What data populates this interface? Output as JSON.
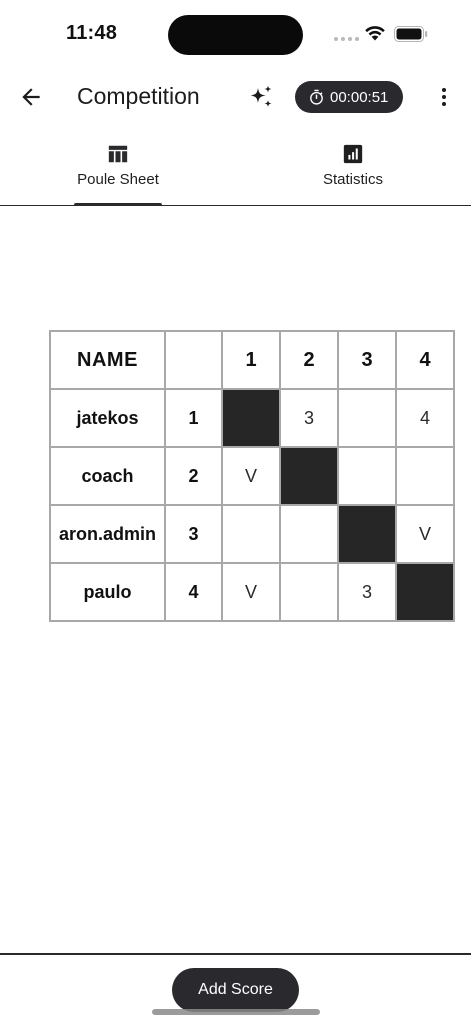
{
  "status_bar": {
    "time": "11:48"
  },
  "app_bar": {
    "title": "Competition",
    "timer": "00:00:51",
    "icons": [
      "back-arrow-icon",
      "sparkle-icon",
      "stopwatch-icon",
      "more-vert-icon"
    ]
  },
  "tabs": [
    {
      "label": "Poule Sheet",
      "icon": "table-icon",
      "active": true
    },
    {
      "label": "Statistics",
      "icon": "bar-chart-icon",
      "active": false
    }
  ],
  "poule": {
    "header": {
      "name": "NAME",
      "number": "",
      "columns": [
        "1",
        "2",
        "3",
        "4"
      ]
    },
    "rows": [
      {
        "name": "jatekos",
        "number": "1",
        "cells": [
          "",
          "3",
          "",
          "4"
        ]
      },
      {
        "name": "coach",
        "number": "2",
        "cells": [
          "V",
          "",
          "",
          ""
        ]
      },
      {
        "name": "aron.admin",
        "number": "3",
        "cells": [
          "",
          "",
          "",
          "V"
        ]
      },
      {
        "name": "paulo",
        "number": "4",
        "cells": [
          "V",
          "",
          "3",
          ""
        ]
      }
    ],
    "blocked_color": "#262626"
  },
  "actions": {
    "add_score_label": "Add Score"
  },
  "colors": {
    "accent_dark": "#2a2a2e",
    "grid_border": "#a8a8a8"
  }
}
